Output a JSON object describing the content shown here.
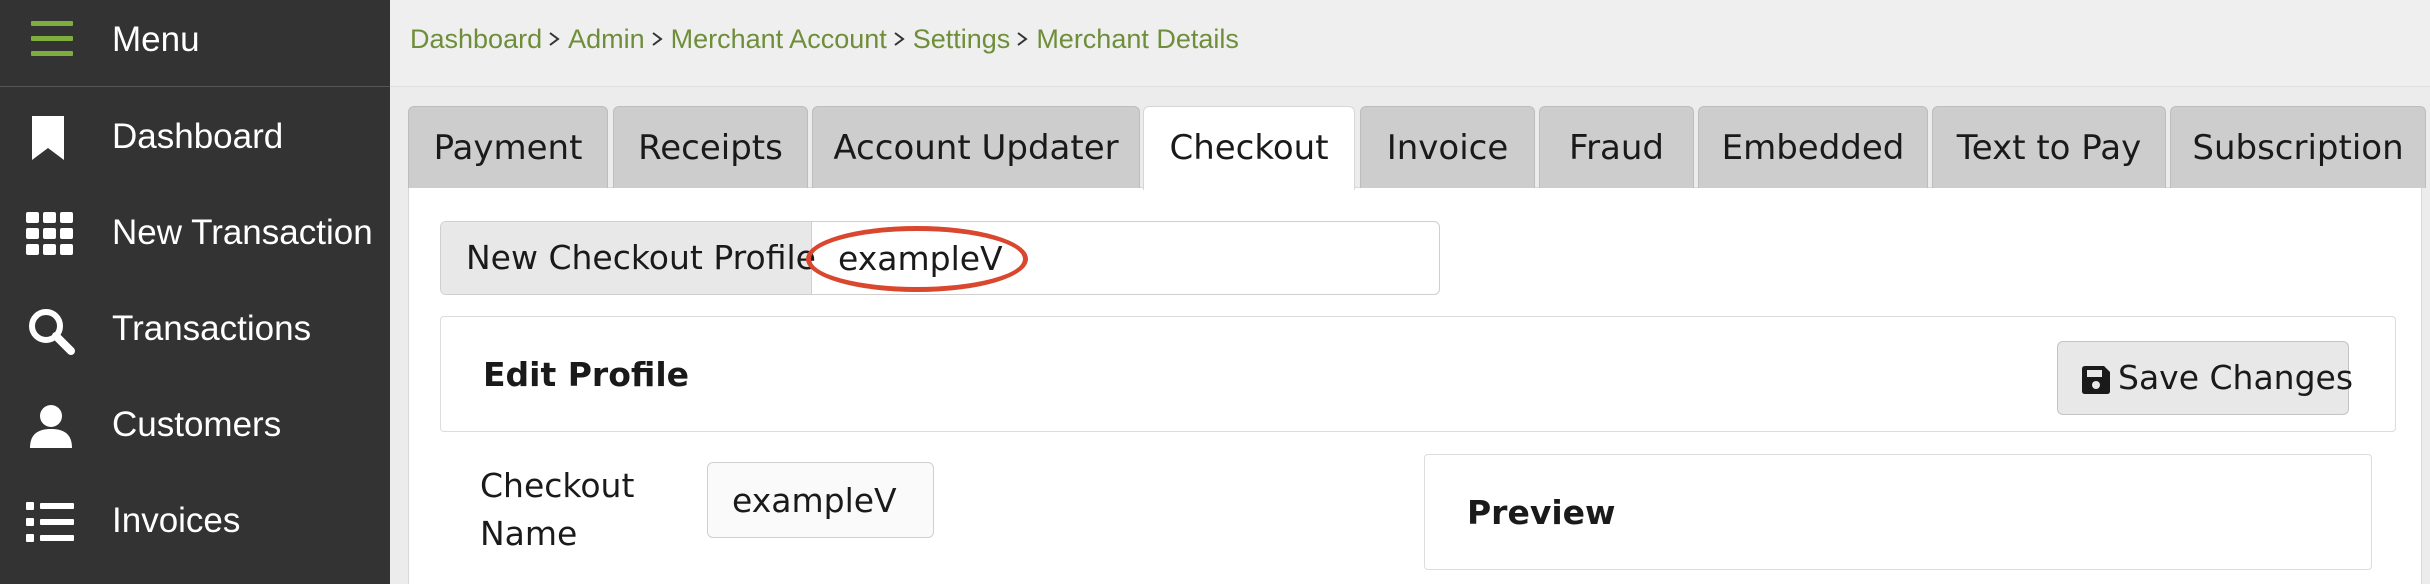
{
  "sidebar": {
    "menu_label": "Menu",
    "items": [
      {
        "label": "Dashboard",
        "icon": "bookmark-icon"
      },
      {
        "label": "New Transaction",
        "icon": "grid-icon"
      },
      {
        "label": "Transactions",
        "icon": "search-icon"
      },
      {
        "label": "Customers",
        "icon": "user-icon"
      },
      {
        "label": "Invoices",
        "icon": "list-icon"
      }
    ]
  },
  "breadcrumb": [
    "Dashboard",
    "Admin",
    "Merchant Account",
    "Settings",
    "Merchant Details"
  ],
  "tabs": [
    {
      "label": "Payment"
    },
    {
      "label": "Receipts"
    },
    {
      "label": "Account Updater"
    },
    {
      "label": "Checkout",
      "active": true
    },
    {
      "label": "Invoice"
    },
    {
      "label": "Fraud"
    },
    {
      "label": "Embedded"
    },
    {
      "label": "Text to Pay"
    },
    {
      "label": "Subscription"
    }
  ],
  "profile": {
    "addon_label": "New Checkout Profile",
    "value": "exampleV"
  },
  "edit_profile": {
    "title": "Edit Profile",
    "save_label": "Save Changes"
  },
  "checkout_name": {
    "label": "Checkout Name",
    "value": "exampleV"
  },
  "preview": {
    "title": "Preview"
  },
  "colors": {
    "sidebar_bg": "#333333",
    "accent_green": "#7fae3f",
    "breadcrumb_link": "#6f8e3a",
    "annotation_red": "#d9472e"
  }
}
